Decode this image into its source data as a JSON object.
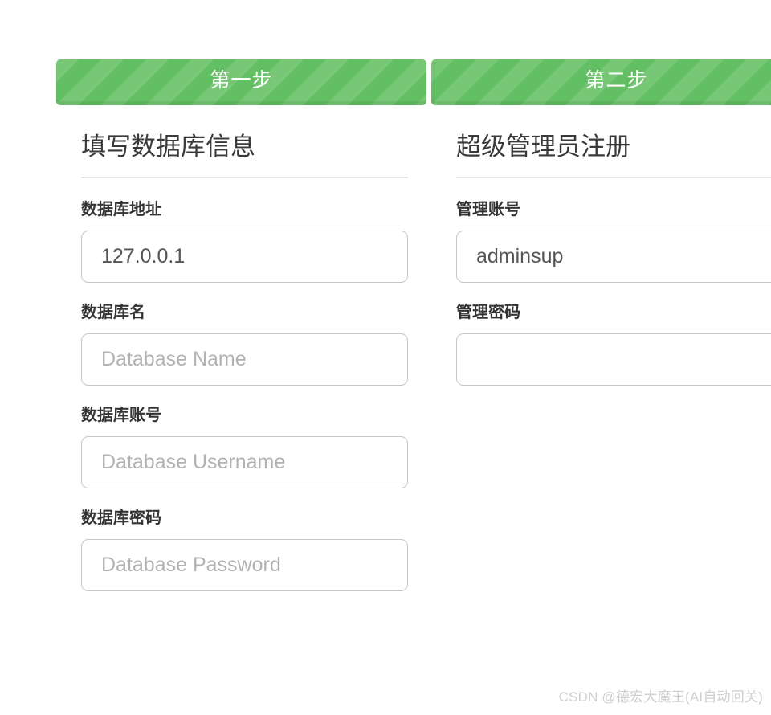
{
  "theme": {
    "accent_green": "#63bf63",
    "label_color": "#333333",
    "value_color": "#555555",
    "placeholder_color": "#b2b2b2",
    "rule_color": "#e4e4e4",
    "input_border": "#c6c6c6",
    "watermark_color": "#cfcfcf",
    "page_background": "#ffffff"
  },
  "steps": [
    {
      "label": "第一步"
    },
    {
      "label": "第二步"
    }
  ],
  "panels": [
    {
      "title": "填写数据库信息",
      "fields": [
        {
          "label": "数据库地址",
          "value": "127.0.0.1",
          "placeholder": ""
        },
        {
          "label": "数据库名",
          "value": "",
          "placeholder": "Database Name"
        },
        {
          "label": "数据库账号",
          "value": "",
          "placeholder": "Database Username"
        },
        {
          "label": "数据库密码",
          "value": "",
          "placeholder": "Database Password"
        }
      ]
    },
    {
      "title": "超级管理员注册",
      "fields": [
        {
          "label": "管理账号",
          "value": "adminsup",
          "placeholder": ""
        },
        {
          "label": "管理密码",
          "value": "",
          "placeholder": ""
        }
      ]
    }
  ],
  "watermark": {
    "text": "CSDN @德宏大魔王(AI自动回关)"
  }
}
